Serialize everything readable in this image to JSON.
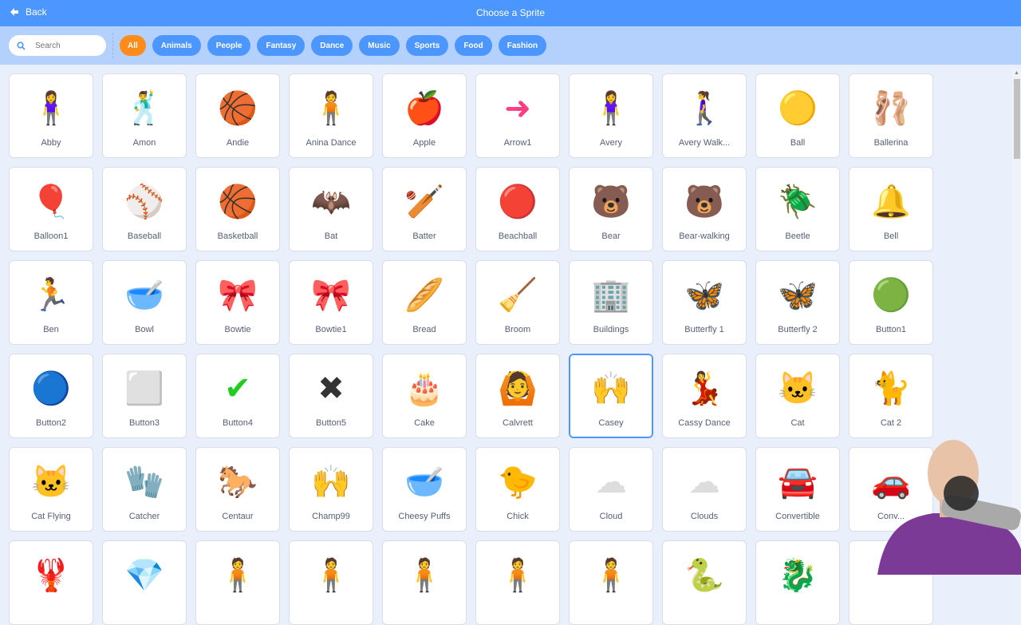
{
  "header": {
    "back_label": "Back",
    "title": "Choose a Sprite"
  },
  "search": {
    "placeholder": "Search",
    "value": ""
  },
  "categories": [
    {
      "label": "All",
      "active": true
    },
    {
      "label": "Animals"
    },
    {
      "label": "People"
    },
    {
      "label": "Fantasy"
    },
    {
      "label": "Dance"
    },
    {
      "label": "Music"
    },
    {
      "label": "Sports"
    },
    {
      "label": "Food"
    },
    {
      "label": "Fashion"
    }
  ],
  "colors": {
    "header": "#4c97ff",
    "filterbar": "#b3d1fc",
    "active_chip": "#ff8c1a",
    "chip": "#4c97ff",
    "background": "#e9f0fc"
  },
  "sprites": [
    {
      "name": "Abby",
      "icon": "🧍‍♀️"
    },
    {
      "name": "Amon",
      "icon": "🕺"
    },
    {
      "name": "Andie",
      "icon": "🏀"
    },
    {
      "name": "Anina Dance",
      "icon": "🧍"
    },
    {
      "name": "Apple",
      "icon": "🍎"
    },
    {
      "name": "Arrow1",
      "icon": "➜"
    },
    {
      "name": "Avery",
      "icon": "🧍‍♀️"
    },
    {
      "name": "Avery Walk...",
      "icon": "🚶‍♀️"
    },
    {
      "name": "Ball",
      "icon": "🟡"
    },
    {
      "name": "Ballerina",
      "icon": "🩰"
    },
    {
      "name": "Balloon1",
      "icon": "🎈"
    },
    {
      "name": "Baseball",
      "icon": "⚾"
    },
    {
      "name": "Basketball",
      "icon": "🏀"
    },
    {
      "name": "Bat",
      "icon": "🦇"
    },
    {
      "name": "Batter",
      "icon": "🏏"
    },
    {
      "name": "Beachball",
      "icon": "🔴"
    },
    {
      "name": "Bear",
      "icon": "🐻"
    },
    {
      "name": "Bear-walking",
      "icon": "🐻"
    },
    {
      "name": "Beetle",
      "icon": "🪲"
    },
    {
      "name": "Bell",
      "icon": "🔔"
    },
    {
      "name": "Ben",
      "icon": "🏃"
    },
    {
      "name": "Bowl",
      "icon": "🥣"
    },
    {
      "name": "Bowtie",
      "icon": "🎀"
    },
    {
      "name": "Bowtie1",
      "icon": "🎀"
    },
    {
      "name": "Bread",
      "icon": "🥖"
    },
    {
      "name": "Broom",
      "icon": "🧹"
    },
    {
      "name": "Buildings",
      "icon": "🏢"
    },
    {
      "name": "Butterfly 1",
      "icon": "🦋"
    },
    {
      "name": "Butterfly 2",
      "icon": "🦋"
    },
    {
      "name": "Button1",
      "icon": "🟢"
    },
    {
      "name": "Button2",
      "icon": "🔵"
    },
    {
      "name": "Button3",
      "icon": "⬜"
    },
    {
      "name": "Button4",
      "icon": "✔"
    },
    {
      "name": "Button5",
      "icon": "✖"
    },
    {
      "name": "Cake",
      "icon": "🎂"
    },
    {
      "name": "Calvrett",
      "icon": "🙆"
    },
    {
      "name": "Casey",
      "icon": "🙌",
      "selected": true
    },
    {
      "name": "Cassy Dance",
      "icon": "💃"
    },
    {
      "name": "Cat",
      "icon": "🐱"
    },
    {
      "name": "Cat 2",
      "icon": "🐈"
    },
    {
      "name": "Cat Flying",
      "icon": "🐱"
    },
    {
      "name": "Catcher",
      "icon": "🧤"
    },
    {
      "name": "Centaur",
      "icon": "🐎"
    },
    {
      "name": "Champ99",
      "icon": "🙌"
    },
    {
      "name": "Cheesy Puffs",
      "icon": "🥣"
    },
    {
      "name": "Chick",
      "icon": "🐤"
    },
    {
      "name": "Cloud",
      "icon": "☁"
    },
    {
      "name": "Clouds",
      "icon": "☁"
    },
    {
      "name": "Convertible",
      "icon": "🚘"
    },
    {
      "name": "Conv...",
      "icon": "🚗"
    },
    {
      "name": "",
      "icon": "🦞"
    },
    {
      "name": "",
      "icon": "💎"
    },
    {
      "name": "",
      "icon": "🧍"
    },
    {
      "name": "",
      "icon": "🧍"
    },
    {
      "name": "",
      "icon": "🧍"
    },
    {
      "name": "",
      "icon": "🧍"
    },
    {
      "name": "",
      "icon": "🧍"
    },
    {
      "name": "",
      "icon": "🐍"
    },
    {
      "name": "",
      "icon": "🐉"
    },
    {
      "name": "",
      "icon": ""
    }
  ]
}
